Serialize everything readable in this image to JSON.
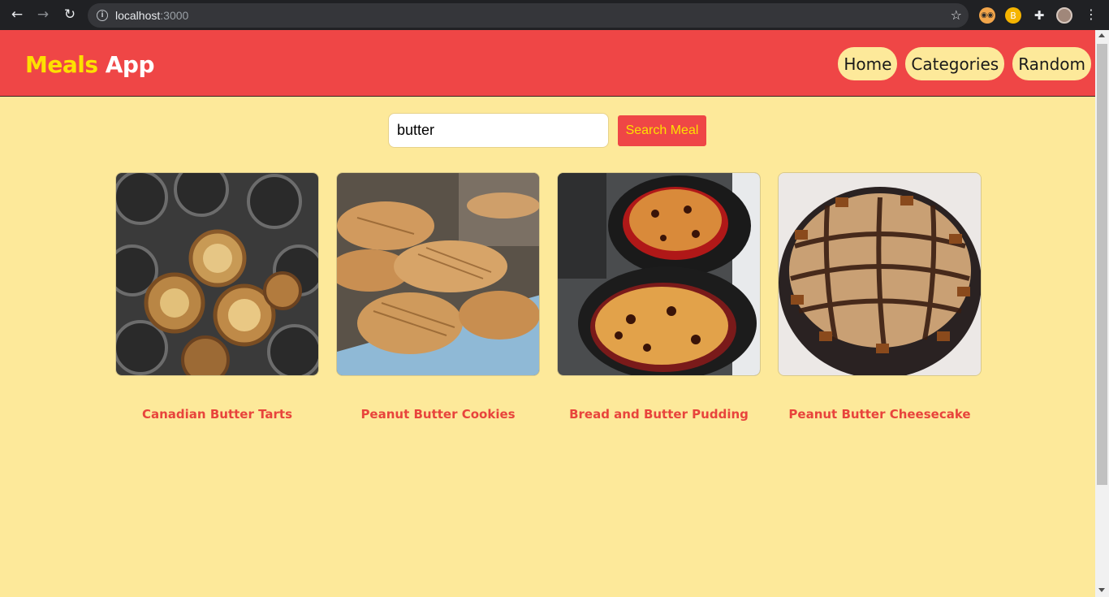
{
  "browser": {
    "url_host": "localhost",
    "url_port": ":3000"
  },
  "header": {
    "logo_part1": "Meals",
    "logo_part2": "App",
    "nav": [
      "Home",
      "Categories",
      "Random"
    ]
  },
  "search": {
    "value": "butter",
    "button_label": "Search Meal"
  },
  "meals": [
    {
      "title": "Canadian Butter Tarts"
    },
    {
      "title": "Peanut Butter Cookies"
    },
    {
      "title": "Bread and Butter Pudding"
    },
    {
      "title": "Peanut Butter Cheesecake"
    }
  ],
  "colors": {
    "page_bg": "#fde99a",
    "header_bg": "#ef4646",
    "logo_accent": "#fde000",
    "title_color": "#e8443c"
  }
}
